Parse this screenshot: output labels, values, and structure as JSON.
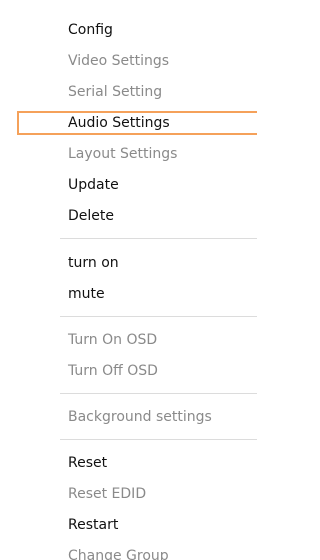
{
  "menu": {
    "highlight_color": "#f5a15a",
    "items": [
      {
        "label": "Config",
        "enabled": true
      },
      {
        "label": "Video Settings",
        "enabled": false
      },
      {
        "label": "Serial Setting",
        "enabled": false
      },
      {
        "label": "Audio Settings",
        "enabled": true,
        "hovered": true
      },
      {
        "label": "Layout Settings",
        "enabled": false
      },
      {
        "label": "Update",
        "enabled": true
      },
      {
        "label": "Delete",
        "enabled": true
      },
      {
        "label": "turn on",
        "enabled": true
      },
      {
        "label": "mute",
        "enabled": true
      },
      {
        "label": "Turn On OSD",
        "enabled": false
      },
      {
        "label": "Turn Off OSD",
        "enabled": false
      },
      {
        "label": "Background settings",
        "enabled": false
      },
      {
        "label": "Reset",
        "enabled": true
      },
      {
        "label": "Reset EDID",
        "enabled": false
      },
      {
        "label": "Restart",
        "enabled": true
      },
      {
        "label": "Change Group",
        "enabled": false
      }
    ]
  }
}
